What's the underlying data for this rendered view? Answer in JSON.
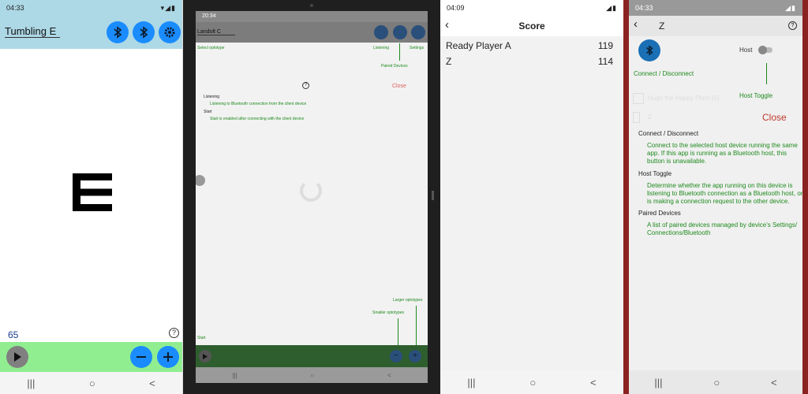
{
  "colors": {
    "accent_blue": "#1a8cff",
    "header_lightblue": "#add8e6",
    "bottom_green": "#90ee90",
    "dark_green_bar": "#2e5e2e",
    "overlay_text_green": "#1e8a1e",
    "close_red": "#c0392b",
    "frame_red": "#8b2222"
  },
  "panel1": {
    "status_time": "04:33",
    "title": "Tumbling E",
    "optotype": "E",
    "counter": "65",
    "icons": [
      "bluetooth-icon",
      "bluetooth-searching-icon",
      "gear-icon",
      "help-icon",
      "play-icon",
      "minus-icon",
      "plus-icon"
    ],
    "nav": [
      "|||",
      "○",
      "<"
    ]
  },
  "panel2": {
    "status_time": "20:34",
    "title": "Landolt C",
    "labels": {
      "select_optotype": "Select optotype",
      "listening": "Listening",
      "settings": "Settings",
      "paired_devices": "Paired Devices",
      "close": "Close",
      "larger_optotypes": "Larger optotypes",
      "smaller_optotypes": "Smaller optotypes",
      "start": "Start"
    },
    "help_entries": [
      {
        "title": "Listening",
        "desc": "Listening to Bluetooth connection from the client device"
      },
      {
        "title": "Start",
        "desc": "Start is enabled after connecting with the client device"
      }
    ],
    "nav": [
      "|||",
      "○",
      "<"
    ]
  },
  "panel3": {
    "status_time": "04:09",
    "title": "Score",
    "rows": [
      {
        "name": "Ready Player A",
        "score": "119"
      },
      {
        "name": "Z",
        "score": "114"
      }
    ],
    "nav": [
      "|||",
      "○",
      "<"
    ]
  },
  "panel4": {
    "status_time": "04:33",
    "title": "Z",
    "host_label": "Host",
    "annot_connect": "Connect / Disconnect",
    "annot_host_toggle": "Host Toggle",
    "bg_items": [
      "Hugo the Happy Plum (5)",
      "Z"
    ],
    "close": "Close",
    "help_entries": [
      {
        "title": "Connect / Disconnect",
        "desc": "Connect to the selected host device running the same app. If this app is running as a Bluetooth host, this button is unavailable."
      },
      {
        "title": "Host Toggle",
        "desc": "Determine whether the app running on this device is listening to Bluetooth connection as a Bluetooth host, or is making a connection request to the other device."
      },
      {
        "title": "Paired Devices",
        "desc": "A list of paired devices managed by device's Settings/ Connections/Bluetooth"
      }
    ],
    "nav": [
      "|||",
      "○",
      "<"
    ]
  }
}
